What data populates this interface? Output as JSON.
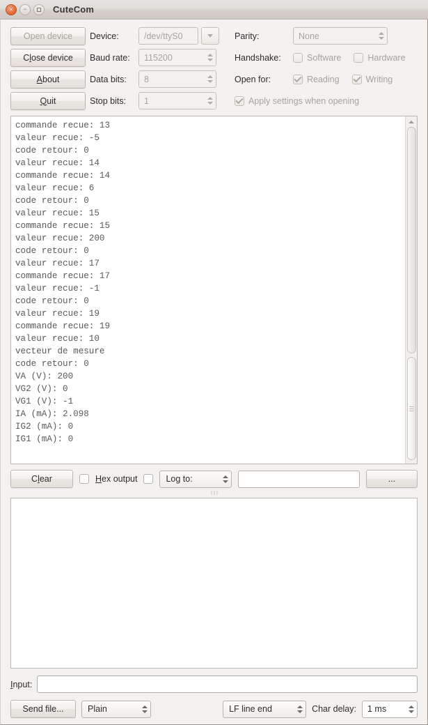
{
  "window": {
    "title": "CuteCom",
    "close_icon": "close-icon",
    "minimize_icon": "minimize-icon",
    "maximize_icon": "maximize-icon"
  },
  "settings": {
    "open_device_label": "Open device",
    "close_device_label": "Close device",
    "about_label": "About",
    "quit_label": "Quit",
    "device_label": "Device:",
    "device_value": "/dev/ttyS0",
    "baud_label": "Baud rate:",
    "baud_value": "115200",
    "data_bits_label": "Data bits:",
    "data_bits_value": "8",
    "stop_bits_label": "Stop bits:",
    "stop_bits_value": "1",
    "parity_label": "Parity:",
    "parity_value": "None",
    "handshake_label": "Handshake:",
    "handshake_software_label": "Software",
    "handshake_hardware_label": "Hardware",
    "open_for_label": "Open for:",
    "open_for_reading_label": "Reading",
    "open_for_writing_label": "Writing",
    "apply_settings_label": "Apply settings when opening"
  },
  "terminal": {
    "lines": [
      "commande recue: 13",
      "valeur recue: -5",
      "code retour: 0",
      "valeur recue: 14",
      "commande recue: 14",
      "valeur recue: 6",
      "code retour: 0",
      "valeur recue: 15",
      "commande recue: 15",
      "valeur recue: 200",
      "code retour: 0",
      "valeur recue: 17",
      "commande recue: 17",
      "valeur recue: -1",
      "code retour: 0",
      "valeur recue: 19",
      "commande recue: 19",
      "valeur recue: 10",
      "vecteur de mesure",
      "code retour: 0",
      "VA (V): 200",
      "VG2 (V): 0",
      "VG1 (V): -1",
      "IA (mA): 2.098",
      "IG2 (mA): 0",
      "IG1 (mA): 0"
    ]
  },
  "toolbar": {
    "clear_label": "Clear",
    "hex_output_label": "Hex output",
    "log_to_label": "Log to:",
    "log_path_value": "",
    "browse_label": "..."
  },
  "input": {
    "label": "Input:",
    "value": ""
  },
  "bottom": {
    "send_file_label": "Send file...",
    "protocol_value": "Plain",
    "line_end_value": "LF line end",
    "char_delay_label": "Char delay:",
    "char_delay_value": "1 ms"
  }
}
